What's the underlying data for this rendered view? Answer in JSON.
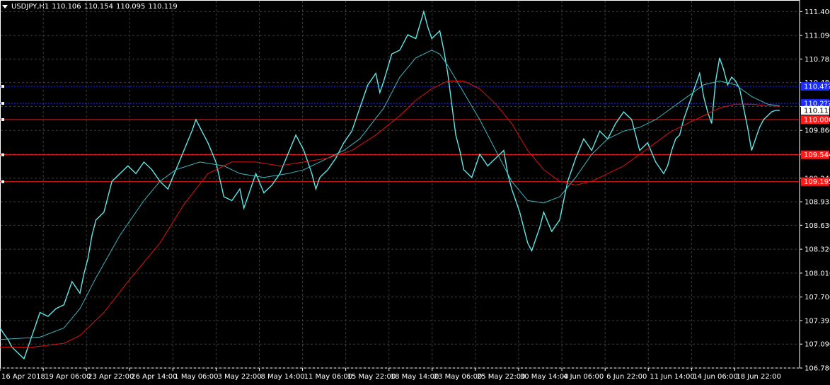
{
  "header": {
    "symbol": "USDJPY,H1",
    "open": "110.106",
    "high": "110.154",
    "low": "110.095",
    "close": "110.119"
  },
  "chart_data": {
    "type": "line",
    "background": "#000000",
    "grid": "dashed",
    "colors": {
      "price": "#5fe8e8",
      "fast_ma": "#3fb6c0",
      "slow_ma": "#e01010",
      "blue_level": "#1a2cff",
      "red_level": "#ff1a1a",
      "current_price_label_bg": "#ffffff"
    },
    "ylim": [
      106.78,
      111.55
    ],
    "y_ticks": [
      "111.400",
      "111.090",
      "110.785",
      "110.480",
      "110.170",
      "109.860",
      "109.550",
      "109.240",
      "108.935",
      "108.630",
      "108.320",
      "108.010",
      "107.700",
      "107.395",
      "107.090",
      "106.780"
    ],
    "x_ticks": [
      "16 Apr 2018",
      "19 Apr 06:00",
      "23 Apr 22:00",
      "26 Apr 14:00",
      "1 May 06:00",
      "3 May 22:00",
      "8 May 14:00",
      "11 May 06:00",
      "15 May 22:00",
      "18 May 14:00",
      "23 May 06:00",
      "25 May 22:00",
      "30 May 14:00",
      "4 Jun 06:00",
      "6 Jun 22:00",
      "11 Jun 14:00",
      "14 Jun 06:00",
      "18 Jun 22:00"
    ],
    "x_tick_positions": [
      0,
      0.0541,
      0.1081,
      0.1622,
      0.2162,
      0.2703,
      0.3243,
      0.3784,
      0.4324,
      0.4865,
      0.5405,
      0.5946,
      0.6486,
      0.7027,
      0.7568,
      0.8108,
      0.8649,
      0.9189
    ],
    "current_price": "110.119",
    "horizontal_levels": [
      {
        "value": 110.43,
        "label": "110.4??",
        "color": "blue"
      },
      {
        "value": 110.21,
        "label": "110.2??",
        "color": "blue"
      },
      {
        "value": 110.0,
        "label": "110.000",
        "color": "red"
      },
      {
        "value": 109.544,
        "label": "109.544",
        "color": "red"
      },
      {
        "value": 109.195,
        "label": "109.195",
        "color": "red"
      }
    ],
    "series": [
      {
        "role": "price",
        "x": [
          0,
          0.005,
          0.01,
          0.015,
          0.02,
          0.025,
          0.03,
          0.035,
          0.04,
          0.045,
          0.05,
          0.06,
          0.07,
          0.08,
          0.09,
          0.1,
          0.105,
          0.11,
          0.115,
          0.12,
          0.125,
          0.13,
          0.14,
          0.15,
          0.16,
          0.17,
          0.18,
          0.19,
          0.2,
          0.21,
          0.22,
          0.23,
          0.24,
          0.245,
          0.25,
          0.255,
          0.26,
          0.27,
          0.28,
          0.29,
          0.3,
          0.305,
          0.31,
          0.32,
          0.33,
          0.34,
          0.35,
          0.36,
          0.37,
          0.38,
          0.39,
          0.395,
          0.4,
          0.41,
          0.42,
          0.43,
          0.44,
          0.45,
          0.46,
          0.47,
          0.475,
          0.48,
          0.49,
          0.5,
          0.51,
          0.52,
          0.53,
          0.535,
          0.54,
          0.55,
          0.555,
          0.56,
          0.565,
          0.57,
          0.575,
          0.58,
          0.59,
          0.6,
          0.61,
          0.62,
          0.63,
          0.635,
          0.64,
          0.645,
          0.65,
          0.655,
          0.66,
          0.665,
          0.67,
          0.675,
          0.68,
          0.69,
          0.7,
          0.705,
          0.71,
          0.72,
          0.73,
          0.74,
          0.75,
          0.76,
          0.77,
          0.78,
          0.79,
          0.8,
          0.81,
          0.82,
          0.83,
          0.835,
          0.84,
          0.845,
          0.85,
          0.855,
          0.86,
          0.865,
          0.87,
          0.875,
          0.88,
          0.885,
          0.89,
          0.895,
          0.9,
          0.905,
          0.91,
          0.915,
          0.92,
          0.925,
          0.93,
          0.935,
          0.94,
          0.945,
          0.95,
          0.955,
          0.96,
          0.965,
          0.97,
          0.975
        ],
        "values": [
          107.3,
          107.22,
          107.15,
          107.05,
          107.0,
          106.95,
          106.9,
          107.05,
          107.2,
          107.35,
          107.5,
          107.45,
          107.55,
          107.6,
          107.9,
          107.75,
          108.0,
          108.2,
          108.5,
          108.7,
          108.75,
          108.8,
          109.2,
          109.3,
          109.4,
          109.3,
          109.45,
          109.35,
          109.2,
          109.1,
          109.35,
          109.6,
          109.85,
          110.0,
          109.9,
          109.8,
          109.7,
          109.45,
          109.0,
          108.95,
          109.1,
          108.85,
          109.0,
          109.3,
          109.05,
          109.15,
          109.3,
          109.55,
          109.8,
          109.6,
          109.3,
          109.1,
          109.25,
          109.35,
          109.5,
          109.7,
          109.85,
          110.15,
          110.45,
          110.6,
          110.35,
          110.5,
          110.85,
          110.9,
          111.1,
          111.05,
          111.4,
          111.2,
          111.05,
          111.15,
          110.9,
          110.6,
          110.2,
          109.8,
          109.6,
          109.35,
          109.25,
          109.55,
          109.4,
          109.5,
          109.6,
          109.3,
          109.1,
          108.95,
          108.8,
          108.6,
          108.4,
          108.3,
          108.45,
          108.6,
          108.8,
          108.55,
          108.7,
          108.95,
          109.2,
          109.5,
          109.75,
          109.6,
          109.85,
          109.75,
          109.95,
          110.1,
          110.0,
          109.6,
          109.7,
          109.45,
          109.3,
          109.4,
          109.6,
          109.75,
          109.8,
          110.0,
          110.15,
          110.3,
          110.45,
          110.6,
          110.3,
          110.1,
          109.95,
          110.5,
          110.8,
          110.65,
          110.45,
          110.55,
          110.5,
          110.4,
          110.15,
          109.9,
          109.6,
          109.75,
          109.9,
          110.0,
          110.05,
          110.1,
          110.12,
          110.119
        ]
      },
      {
        "role": "fast_ma",
        "x": [
          0,
          0.05,
          0.08,
          0.1,
          0.12,
          0.15,
          0.18,
          0.2,
          0.22,
          0.25,
          0.28,
          0.3,
          0.33,
          0.36,
          0.38,
          0.4,
          0.43,
          0.45,
          0.48,
          0.5,
          0.52,
          0.54,
          0.55,
          0.56,
          0.58,
          0.6,
          0.62,
          0.64,
          0.66,
          0.68,
          0.7,
          0.72,
          0.74,
          0.76,
          0.78,
          0.8,
          0.82,
          0.84,
          0.86,
          0.88,
          0.9,
          0.92,
          0.94,
          0.96,
          0.975
        ],
        "values": [
          107.15,
          107.18,
          107.3,
          107.55,
          107.95,
          108.5,
          108.95,
          109.2,
          109.35,
          109.45,
          109.4,
          109.3,
          109.25,
          109.3,
          109.35,
          109.45,
          109.6,
          109.75,
          110.15,
          110.55,
          110.8,
          110.9,
          110.85,
          110.7,
          110.35,
          110.0,
          109.6,
          109.2,
          108.95,
          108.92,
          109.0,
          109.25,
          109.55,
          109.75,
          109.85,
          109.9,
          110.0,
          110.15,
          110.3,
          110.45,
          110.5,
          110.45,
          110.3,
          110.2,
          110.18
        ]
      },
      {
        "role": "slow_ma",
        "x": [
          0,
          0.04,
          0.08,
          0.1,
          0.13,
          0.16,
          0.2,
          0.23,
          0.26,
          0.29,
          0.32,
          0.35,
          0.38,
          0.41,
          0.44,
          0.47,
          0.5,
          0.52,
          0.54,
          0.56,
          0.58,
          0.6,
          0.62,
          0.64,
          0.66,
          0.68,
          0.7,
          0.72,
          0.74,
          0.76,
          0.78,
          0.8,
          0.82,
          0.84,
          0.86,
          0.88,
          0.9,
          0.92,
          0.94,
          0.96,
          0.975
        ],
        "values": [
          107.05,
          107.05,
          107.1,
          107.2,
          107.5,
          107.9,
          108.4,
          108.9,
          109.3,
          109.45,
          109.45,
          109.4,
          109.45,
          109.5,
          109.6,
          109.8,
          110.05,
          110.25,
          110.4,
          110.5,
          110.5,
          110.4,
          110.2,
          109.95,
          109.6,
          109.35,
          109.2,
          109.15,
          109.2,
          109.3,
          109.4,
          109.55,
          109.7,
          109.85,
          109.95,
          110.05,
          110.15,
          110.2,
          110.2,
          110.18,
          110.17
        ]
      }
    ]
  }
}
